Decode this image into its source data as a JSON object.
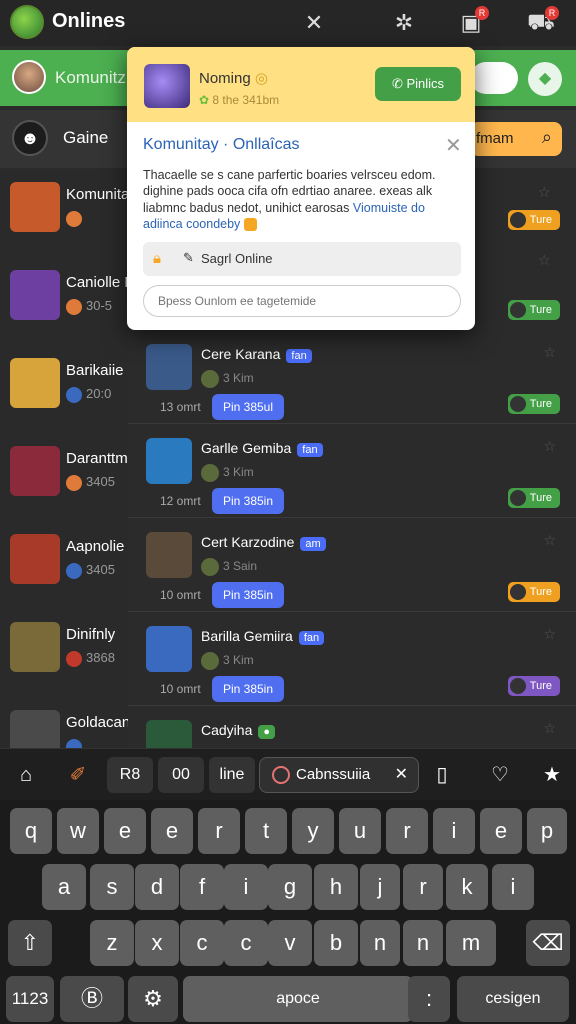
{
  "topbar": {
    "title": "Onlines",
    "icons": [
      "close-icon",
      "bug-icon",
      "shop-icon",
      "cart-icon"
    ],
    "badges": [
      "R",
      "R"
    ]
  },
  "greenbar": {
    "title": "Komunitz"
  },
  "games": {
    "title": "Gaine",
    "search_label": "fmam"
  },
  "left_list": [
    {
      "name": "Komunita",
      "meta": "",
      "color": "#c65a2a"
    },
    {
      "name": "Caniolle N",
      "meta": "30-5",
      "color": "#6d3fa0"
    },
    {
      "name": "Barikaiie",
      "meta": "20:0",
      "color": "#d6a43a"
    },
    {
      "name": "Daranttm",
      "meta": "3405",
      "color": "#8a2a3a"
    },
    {
      "name": "Aapnolie",
      "meta": "3405",
      "color": "#a83a2a"
    },
    {
      "name": "Dinifnly",
      "meta": "3868",
      "color": "#7a6a3a"
    },
    {
      "name": "Goldacant",
      "meta": "",
      "color": "#4a4a4a"
    }
  ],
  "mid_list": [
    {
      "name": "Cere Karana",
      "tag": "fan",
      "sub": "3 Kim",
      "time": "13 omrt",
      "btn": "Pin 385ul",
      "pill": "Ture",
      "pill_color": "#43a047",
      "thumb": "#3a5a8a"
    },
    {
      "name": "Garlle Gemiba",
      "tag": "fan",
      "sub": "3 Kim",
      "time": "12 omrt",
      "btn": "Pin 385in",
      "pill": "Ture",
      "pill_color": "#43a047",
      "thumb": "#2a7ac0"
    },
    {
      "name": "Cert Karzodine",
      "tag": "am",
      "sub": "3 Sain",
      "time": "10 omrt",
      "btn": "Pin 385in",
      "pill": "Ture",
      "pill_color": "#f0a020",
      "thumb": "#5a4a3a"
    },
    {
      "name": "Barilla Gemiira",
      "tag": "fan",
      "sub": "3 Kim",
      "time": "10 omrt",
      "btn": "Pin 385in",
      "pill": "Ture",
      "pill_color": "#7e57c2",
      "thumb": "#3a6ac0"
    },
    {
      "name": "Cadyiha",
      "tag": "",
      "sub": "",
      "time": "",
      "btn": "",
      "pill": "",
      "pill_color": "#43a047",
      "thumb": "#2a5a3a"
    }
  ],
  "top_pills": [
    {
      "label": "Ture",
      "color": "#f0a020"
    },
    {
      "label": "Ture",
      "color": "#43a047"
    }
  ],
  "popup": {
    "name": "Noming",
    "sub": "8 the 341bm",
    "button": "Pinlics",
    "title": "Komunitay · Onllaîcas",
    "body": "Thacaelle se s cane parfertic boaries velrsceu edom. dighine pads ooca cifa ofn edrtiao anaree. exeas alk liabmnc badus nedot, unihict earosas",
    "body_link": "Viomuiste do adiinca coondeby",
    "row_label": "Sagrl Online",
    "input_placeholder": "Bpess Ounlom ee tagetemide"
  },
  "kb_toolbar": {
    "keys": [
      "R8",
      "00",
      "line"
    ],
    "chip": "Cabnssuiia"
  },
  "keyboard": {
    "row1": [
      "q",
      "w",
      "e",
      "e",
      "r",
      "t",
      "y",
      "u",
      "r",
      "i",
      "e",
      "p"
    ],
    "row2": [
      "a",
      "s",
      "d",
      "f",
      "i",
      "g",
      "h",
      "j",
      "r",
      "k",
      "i"
    ],
    "row3": [
      "z",
      "x",
      "c",
      "c",
      "v",
      "b",
      "n",
      "n",
      "m"
    ],
    "num_label": "1123",
    "space_label": "apoce",
    "dot_label": ":",
    "enter_label": "cesigen"
  }
}
